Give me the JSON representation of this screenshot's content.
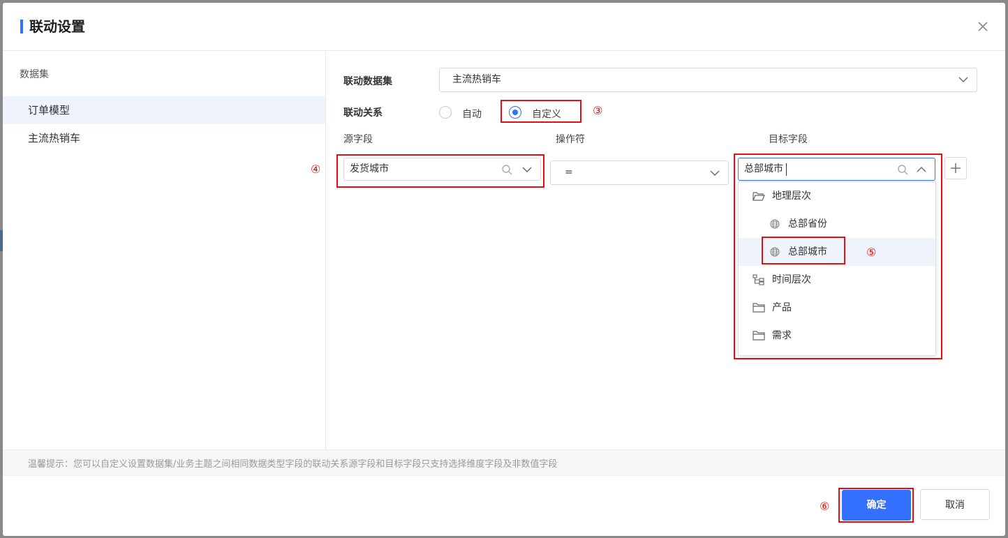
{
  "dialog": {
    "title": "联动设置"
  },
  "left_pane": {
    "heading": "数据集",
    "items": [
      {
        "label": "订单模型",
        "active": true
      },
      {
        "label": "主流热销车",
        "active": false
      }
    ]
  },
  "form": {
    "dataset_label": "联动数据集",
    "dataset_value": "主流热销车",
    "relation_label": "联动关系",
    "relation_options": [
      {
        "label": "自动",
        "checked": false
      },
      {
        "label": "自定义",
        "checked": true
      }
    ],
    "source_field_header": "源字段",
    "operator_header": "操作符",
    "target_field_header": "目标字段",
    "source_value": "发货城市",
    "operator_value": "=",
    "target_input_value": "总部城市"
  },
  "target_dropdown": {
    "items": [
      {
        "label": "地理层次",
        "icon": "folder-open-icon",
        "indent": 0,
        "selected": false
      },
      {
        "label": "总部省份",
        "icon": "globe-icon",
        "indent": 1,
        "selected": false
      },
      {
        "label": "总部城市",
        "icon": "globe-icon",
        "indent": 1,
        "selected": true
      },
      {
        "label": "时间层次",
        "icon": "hierarchy-icon",
        "indent": 0,
        "selected": false
      },
      {
        "label": "产品",
        "icon": "folder-icon",
        "indent": 0,
        "selected": false
      },
      {
        "label": "需求",
        "icon": "folder-icon",
        "indent": 0,
        "selected": false
      }
    ]
  },
  "annotations": {
    "n3": "③",
    "n4": "④",
    "n5": "⑤",
    "n6": "⑥"
  },
  "tip": "温馨提示：您可以自定义设置数据集/业务主题之间相同数据类型字段的联动关系源字段和目标字段只支持选择维度字段及非数值字段",
  "footer": {
    "confirm_label": "确定",
    "cancel_label": "取消"
  },
  "colors": {
    "accent": "#3370ff",
    "annotation_red": "#e4100f"
  }
}
